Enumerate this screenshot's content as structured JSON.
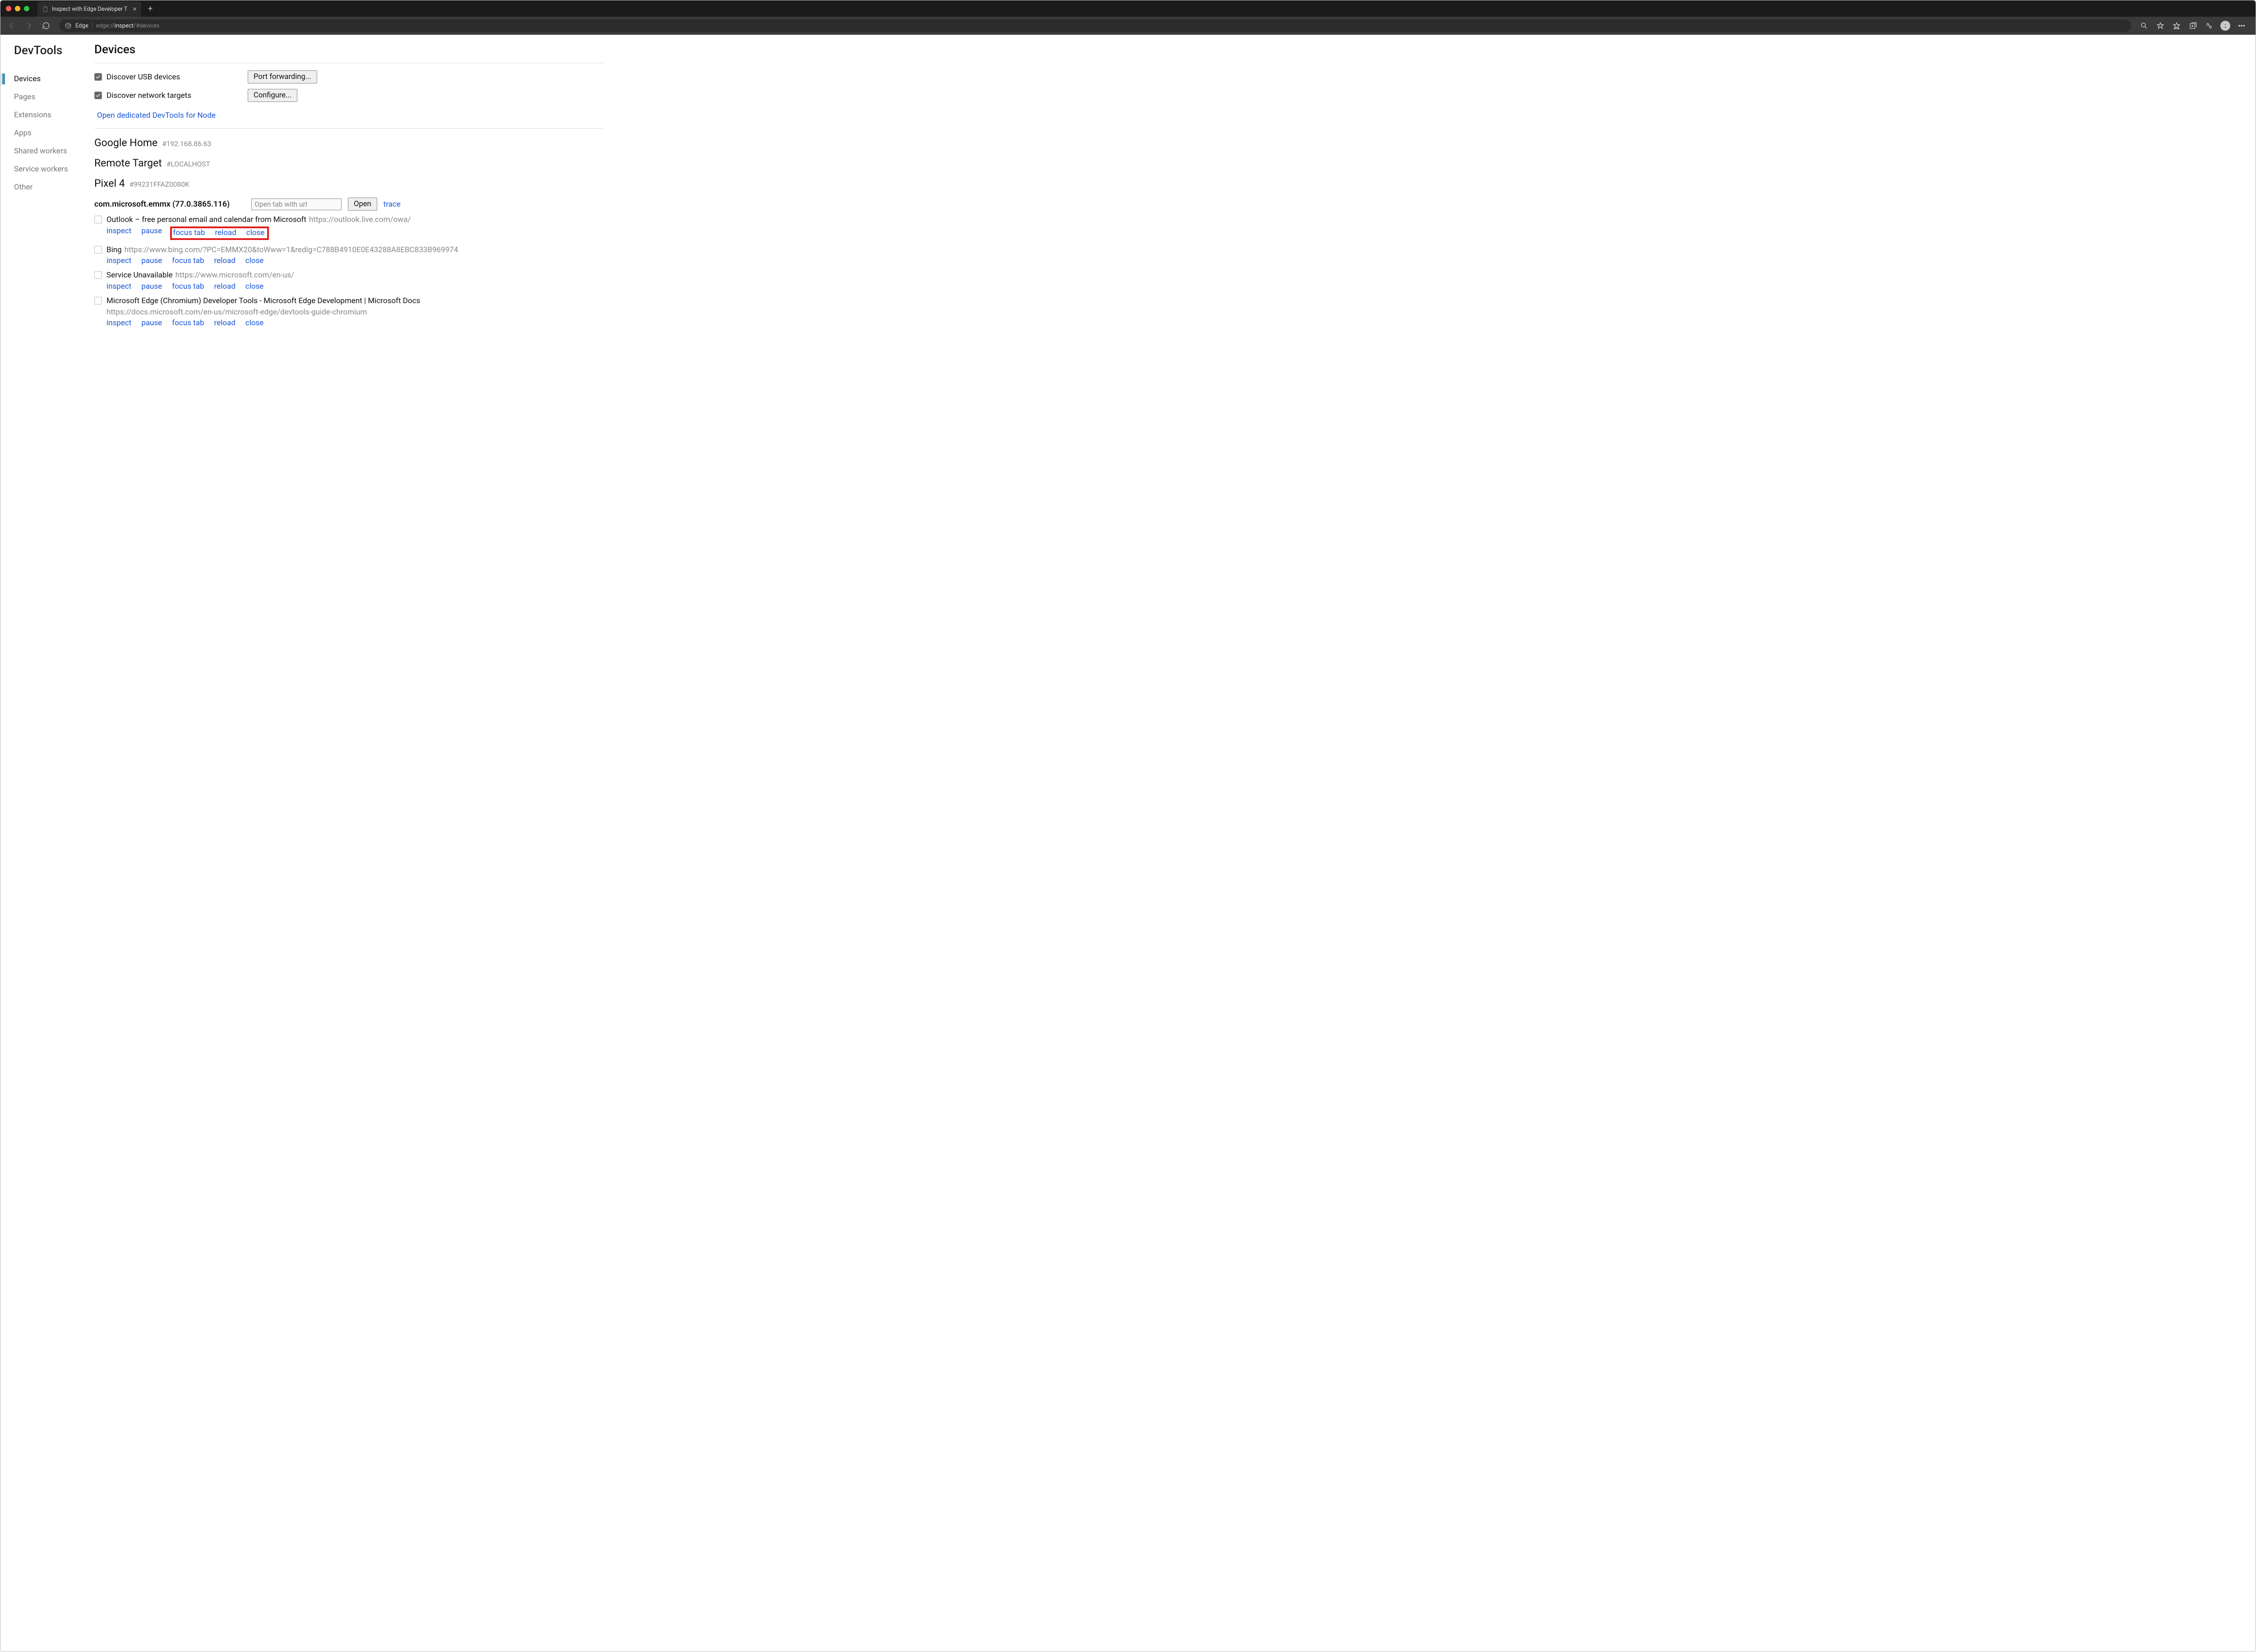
{
  "window": {
    "tab_title": "Inspect with Edge Developer T",
    "new_tab_tooltip": "+"
  },
  "addressbar": {
    "browser_label": "Edge",
    "url_dim_prefix": "edge://",
    "url_bright": "inspect",
    "url_dim_suffix": "/#devices"
  },
  "sidebar": {
    "title": "DevTools",
    "items": [
      {
        "label": "Devices",
        "active": true
      },
      {
        "label": "Pages"
      },
      {
        "label": "Extensions"
      },
      {
        "label": "Apps"
      },
      {
        "label": "Shared workers"
      },
      {
        "label": "Service workers"
      },
      {
        "label": "Other"
      }
    ]
  },
  "page": {
    "title": "Devices",
    "discover_usb_label": "Discover USB devices",
    "port_forwarding_btn": "Port forwarding...",
    "discover_network_label": "Discover network targets",
    "configure_btn": "Configure...",
    "node_link": "Open dedicated DevTools for Node"
  },
  "sections": [
    {
      "title": "Google Home",
      "sub": "#192.168.86.63"
    },
    {
      "title": "Remote Target",
      "sub": "#LOCALHOST"
    },
    {
      "title": "Pixel 4",
      "sub": "#99231FFAZ0080K"
    }
  ],
  "browser": {
    "name": "com.microsoft.emmx (77.0.3865.116)",
    "url_placeholder": "Open tab with url",
    "open_btn": "Open",
    "trace_link": "trace"
  },
  "actions": {
    "inspect": "inspect",
    "pause": "pause",
    "focus_tab": "focus tab",
    "reload": "reload",
    "close": "close"
  },
  "tabs": [
    {
      "title": "Outlook – free personal email and calendar from Microsoft",
      "url": "https://outlook.live.com/owa/",
      "highlight_box": true
    },
    {
      "title": "Bing",
      "url": "https://www.bing.com/?PC=EMMX20&toWww=1&redig=C788B4910E0E43288A8EBC833B969974"
    },
    {
      "title": "Service Unavailable",
      "url": "https://www.microsoft.com/en-us/"
    },
    {
      "title": "Microsoft Edge (Chromium) Developer Tools - Microsoft Edge Development | Microsoft Docs",
      "url": "https://docs.microsoft.com/en-us/microsoft-edge/devtools-guide-chromium",
      "url_below": true
    }
  ]
}
